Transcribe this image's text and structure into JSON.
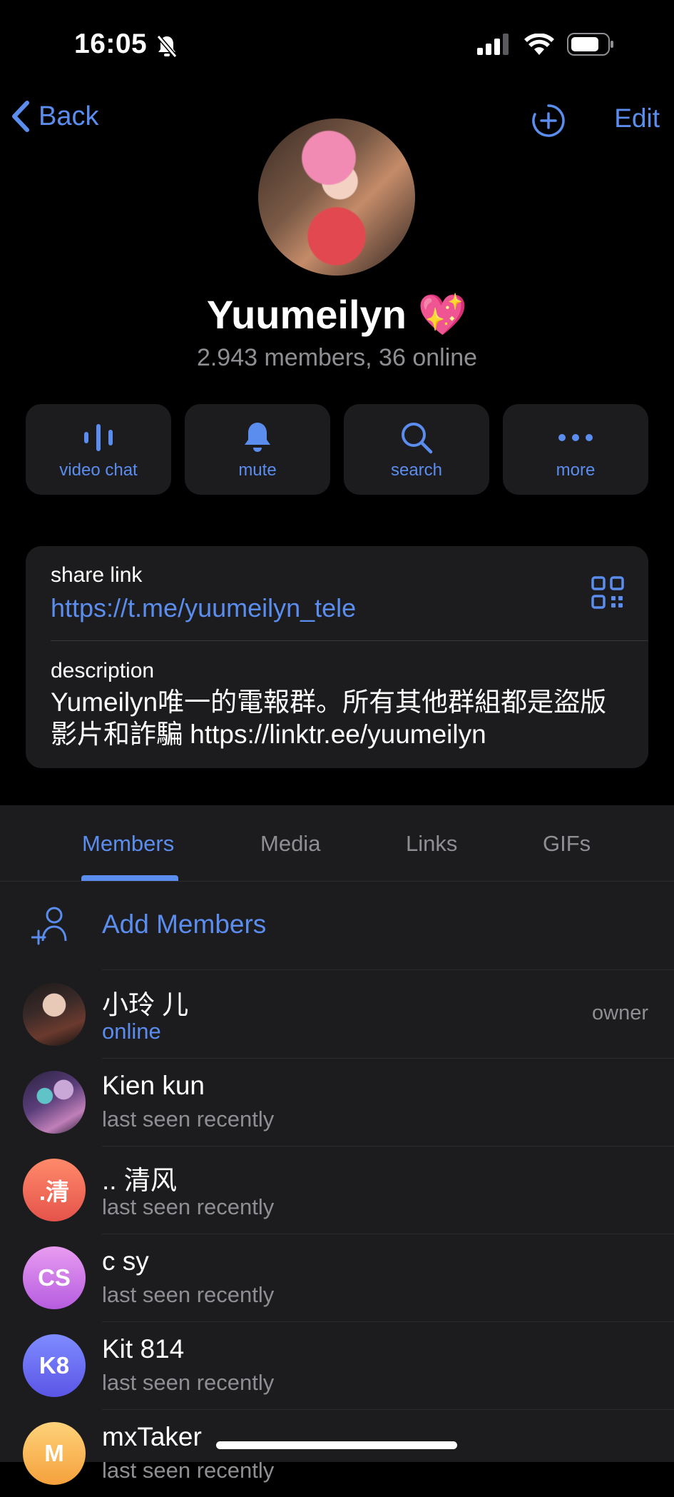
{
  "status_bar": {
    "time": "16:05"
  },
  "nav": {
    "back_label": "Back",
    "edit_label": "Edit"
  },
  "profile": {
    "name": "Yuumeilyn 💖",
    "subtitle": "2.943 members, 36 online"
  },
  "actions": [
    {
      "label": "video chat",
      "icon": "video-chat-icon"
    },
    {
      "label": "mute",
      "icon": "bell-icon"
    },
    {
      "label": "search",
      "icon": "search-icon"
    },
    {
      "label": "more",
      "icon": "more-icon"
    }
  ],
  "info": {
    "share_label": "share link",
    "share_url": "https://t.me/yuumeilyn_tele",
    "description_label": "description",
    "description_line1": "Yumeilyn唯一的電報群。所有其他群組都是盜版",
    "description_line2": "影片和詐騙 https://linktr.ee/yuumeilyn"
  },
  "tabs": [
    {
      "label": "Members",
      "active": true
    },
    {
      "label": "Media",
      "active": false
    },
    {
      "label": "Links",
      "active": false
    },
    {
      "label": "GIFs",
      "active": false
    }
  ],
  "add_members_label": "Add Members",
  "members": [
    {
      "name": "小玲 儿",
      "status": "online",
      "role": "owner",
      "initials": ""
    },
    {
      "name": "Kien kun",
      "status": "last seen recently",
      "role": "",
      "initials": ""
    },
    {
      "name": ".. 清风",
      "status": "last seen recently",
      "role": "",
      "initials": ".清"
    },
    {
      "name": "c sy",
      "status": "last seen recently",
      "role": "",
      "initials": "CS"
    },
    {
      "name": "Kit 814",
      "status": "last seen recently",
      "role": "",
      "initials": "K8"
    },
    {
      "name": "mxTaker",
      "status": "last seen recently",
      "role": "",
      "initials": "M"
    }
  ],
  "colors": {
    "accent": "#5b8def",
    "background": "#000000",
    "card": "#1c1c1e",
    "secondary_text": "#8e8e93"
  }
}
